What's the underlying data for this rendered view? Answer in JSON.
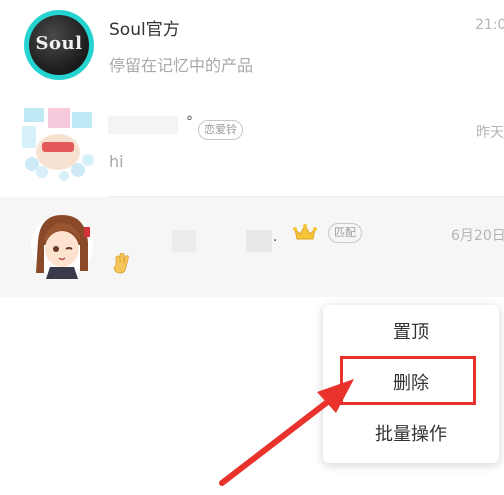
{
  "conversations": [
    {
      "name": "Soul官方",
      "preview": "停留在记忆中的产品",
      "time": "21:0",
      "avatar_logo": "Soul"
    },
    {
      "name_suffix": "°",
      "tag": "恋爱铃",
      "preview": "hi",
      "time": "昨天"
    },
    {
      "name_suffix": ".",
      "tag": "匹配",
      "preview_icon": "hand-emoji",
      "time": "6月20日"
    }
  ],
  "context_menu": {
    "items": [
      "置顶",
      "删除",
      "批量操作"
    ],
    "highlighted_item": "删除"
  },
  "colors": {
    "accent_cyan": "#25d4d0",
    "highlight_red": "#e8322b",
    "crown_gold": "#f4c43a"
  }
}
